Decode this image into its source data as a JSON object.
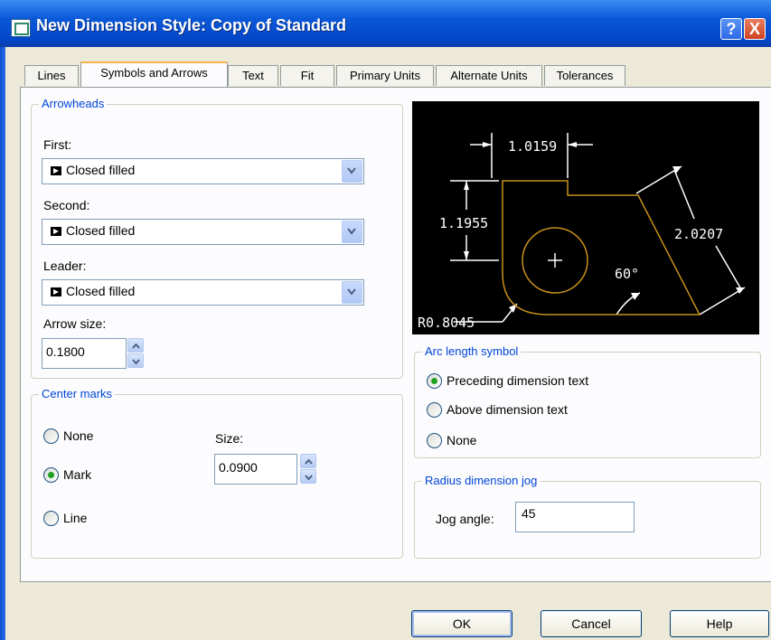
{
  "window": {
    "title": "New Dimension Style: Copy of Standard",
    "help": "?",
    "close": "X"
  },
  "tabs": [
    "Lines",
    "Symbols and Arrows",
    "Text",
    "Fit",
    "Primary Units",
    "Alternate Units",
    "Tolerances"
  ],
  "arrowheads": {
    "legend": "Arrowheads",
    "first_label": "First:",
    "first_value": "Closed filled",
    "second_label": "Second:",
    "second_value": "Closed filled",
    "leader_label": "Leader:",
    "leader_value": "Closed filled",
    "size_label": "Arrow size:",
    "size_value": "0.1800"
  },
  "center_marks": {
    "legend": "Center marks",
    "none": "None",
    "mark": "Mark",
    "line": "Line",
    "selected": "Mark",
    "size_label": "Size:",
    "size_value": "0.0900"
  },
  "preview": {
    "dim_top": "1.0159",
    "dim_left": "1.1955",
    "dim_right": "2.0207",
    "angle": "60°",
    "radius": "R0.8045"
  },
  "arc_length": {
    "legend": "Arc length symbol",
    "preceding": "Preceding dimension text",
    "above": "Above dimension text",
    "none": "None",
    "selected": "Preceding dimension text"
  },
  "radius_jog": {
    "legend": "Radius dimension jog",
    "angle_label": "Jog angle:",
    "angle_value": "45"
  },
  "buttons": {
    "ok": "OK",
    "cancel": "Cancel",
    "help": "Help"
  },
  "colors": {
    "title_bar": "#0a58d8",
    "group_legend": "#0046d5",
    "preview_bg": "#000000",
    "preview_geometry": "#c8901a"
  }
}
